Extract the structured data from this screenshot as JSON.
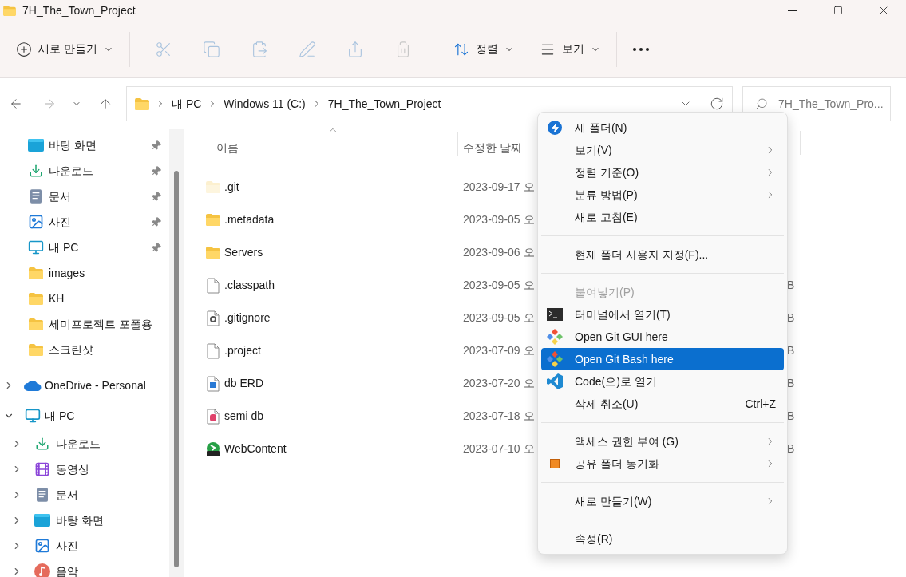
{
  "window": {
    "title": "7H_The_Town_Project"
  },
  "toolbar": {
    "new_button": {
      "label": "새로 만들기"
    },
    "sort_button": {
      "label": "정렬"
    },
    "view_button": {
      "label": "보기"
    }
  },
  "address_bar": {
    "crumbs": [
      "내 PC",
      "Windows 11 (C:)",
      "7H_The_Town_Project"
    ]
  },
  "search": {
    "placeholder": "7H_The_Town_Pro..."
  },
  "sidebar": {
    "quick_access": [
      {
        "label": "바탕 화면",
        "kind": "desktop",
        "pinned": true
      },
      {
        "label": "다운로드",
        "kind": "download",
        "pinned": true
      },
      {
        "label": "문서",
        "kind": "documents",
        "pinned": true
      },
      {
        "label": "사진",
        "kind": "pictures",
        "pinned": true
      },
      {
        "label": "내 PC",
        "kind": "pc",
        "pinned": true
      },
      {
        "label": "images",
        "kind": "folder",
        "pinned": false
      },
      {
        "label": "KH",
        "kind": "folder",
        "pinned": false
      },
      {
        "label": "세미프로젝트 포폴용",
        "kind": "folder",
        "pinned": false
      },
      {
        "label": "스크린샷",
        "kind": "folder",
        "pinned": false
      }
    ],
    "tree": [
      {
        "label": "OneDrive - Personal",
        "kind": "cloud",
        "expanded": false
      },
      {
        "label": "내 PC",
        "kind": "pc",
        "expanded": true,
        "children": [
          {
            "label": "다운로드",
            "kind": "download",
            "expanded": false
          },
          {
            "label": "동영상",
            "kind": "video",
            "expanded": false
          },
          {
            "label": "문서",
            "kind": "documents",
            "expanded": false
          },
          {
            "label": "바탕 화면",
            "kind": "desktop",
            "expanded": false
          },
          {
            "label": "사진",
            "kind": "pictures",
            "expanded": false
          },
          {
            "label": "음악",
            "kind": "music",
            "expanded": false
          }
        ]
      }
    ]
  },
  "file_list": {
    "columns": [
      "이름",
      "수정한 날짜"
    ],
    "rows": [
      {
        "name": ".git",
        "kind": "folder",
        "hidden": true,
        "modified": "2023-09-17 오"
      },
      {
        "name": ".metadata",
        "kind": "folder",
        "hidden": false,
        "modified": "2023-09-05 오"
      },
      {
        "name": "Servers",
        "kind": "folder",
        "hidden": false,
        "modified": "2023-09-06 오"
      },
      {
        "name": ".classpath",
        "kind": "file",
        "hidden": false,
        "modified": "2023-09-05 오",
        "size": "B"
      },
      {
        "name": ".gitignore",
        "kind": "config",
        "hidden": false,
        "modified": "2023-09-05 오",
        "size": "B"
      },
      {
        "name": ".project",
        "kind": "file",
        "hidden": false,
        "modified": "2023-07-09 오",
        "size": "B"
      },
      {
        "name": "db ERD",
        "kind": "image",
        "hidden": false,
        "modified": "2023-07-20 오",
        "size": "B"
      },
      {
        "name": "semi db",
        "kind": "database",
        "hidden": false,
        "modified": "2023-07-18 오",
        "size": "B"
      },
      {
        "name": "WebContent",
        "kind": "app",
        "hidden": false,
        "modified": "2023-07-10 오",
        "size": "B"
      }
    ]
  },
  "context_menu": {
    "items": [
      {
        "kind": "item",
        "label": "새 폴더(N)",
        "submenu": false,
        "disabled": false,
        "selected": false
      },
      {
        "kind": "item",
        "label": "보기(V)",
        "submenu": true,
        "disabled": false,
        "selected": false
      },
      {
        "kind": "item",
        "label": "정렬 기준(O)",
        "submenu": true,
        "disabled": false,
        "selected": false
      },
      {
        "kind": "item",
        "label": "분류 방법(P)",
        "submenu": true,
        "disabled": false,
        "selected": false
      },
      {
        "kind": "item",
        "label": "새로 고침(E)",
        "submenu": false,
        "disabled": false,
        "selected": false
      },
      {
        "kind": "separator"
      },
      {
        "kind": "item",
        "label": "현재 폴더 사용자 지정(F)...",
        "submenu": false,
        "disabled": false,
        "selected": false
      },
      {
        "kind": "separator"
      },
      {
        "kind": "item",
        "label": "붙여넣기(P)",
        "submenu": false,
        "disabled": true,
        "selected": false
      },
      {
        "kind": "item",
        "label": "터미널에서 열기(T)",
        "submenu": false,
        "disabled": false,
        "selected": false
      },
      {
        "kind": "item",
        "label": "Open Git GUI here",
        "submenu": false,
        "disabled": false,
        "selected": false
      },
      {
        "kind": "item",
        "label": "Open Git Bash here",
        "submenu": false,
        "disabled": false,
        "selected": true
      },
      {
        "kind": "item",
        "label": "Code(으)로 열기",
        "submenu": false,
        "disabled": false,
        "selected": false
      },
      {
        "kind": "item",
        "label": "삭제 취소(U)",
        "shortcut": "Ctrl+Z",
        "submenu": false,
        "disabled": false,
        "selected": false
      },
      {
        "kind": "separator"
      },
      {
        "kind": "item",
        "label": "액세스 권한 부여 (G)",
        "submenu": true,
        "disabled": false,
        "selected": false
      },
      {
        "kind": "item",
        "label": "공유 폴더 동기화",
        "submenu": true,
        "disabled": false,
        "selected": false
      },
      {
        "kind": "separator"
      },
      {
        "kind": "item",
        "label": "새로 만들기(W)",
        "submenu": true,
        "disabled": false,
        "selected": false
      },
      {
        "kind": "separator"
      },
      {
        "kind": "item",
        "label": "속성(R)",
        "submenu": false,
        "disabled": false,
        "selected": false
      }
    ]
  }
}
